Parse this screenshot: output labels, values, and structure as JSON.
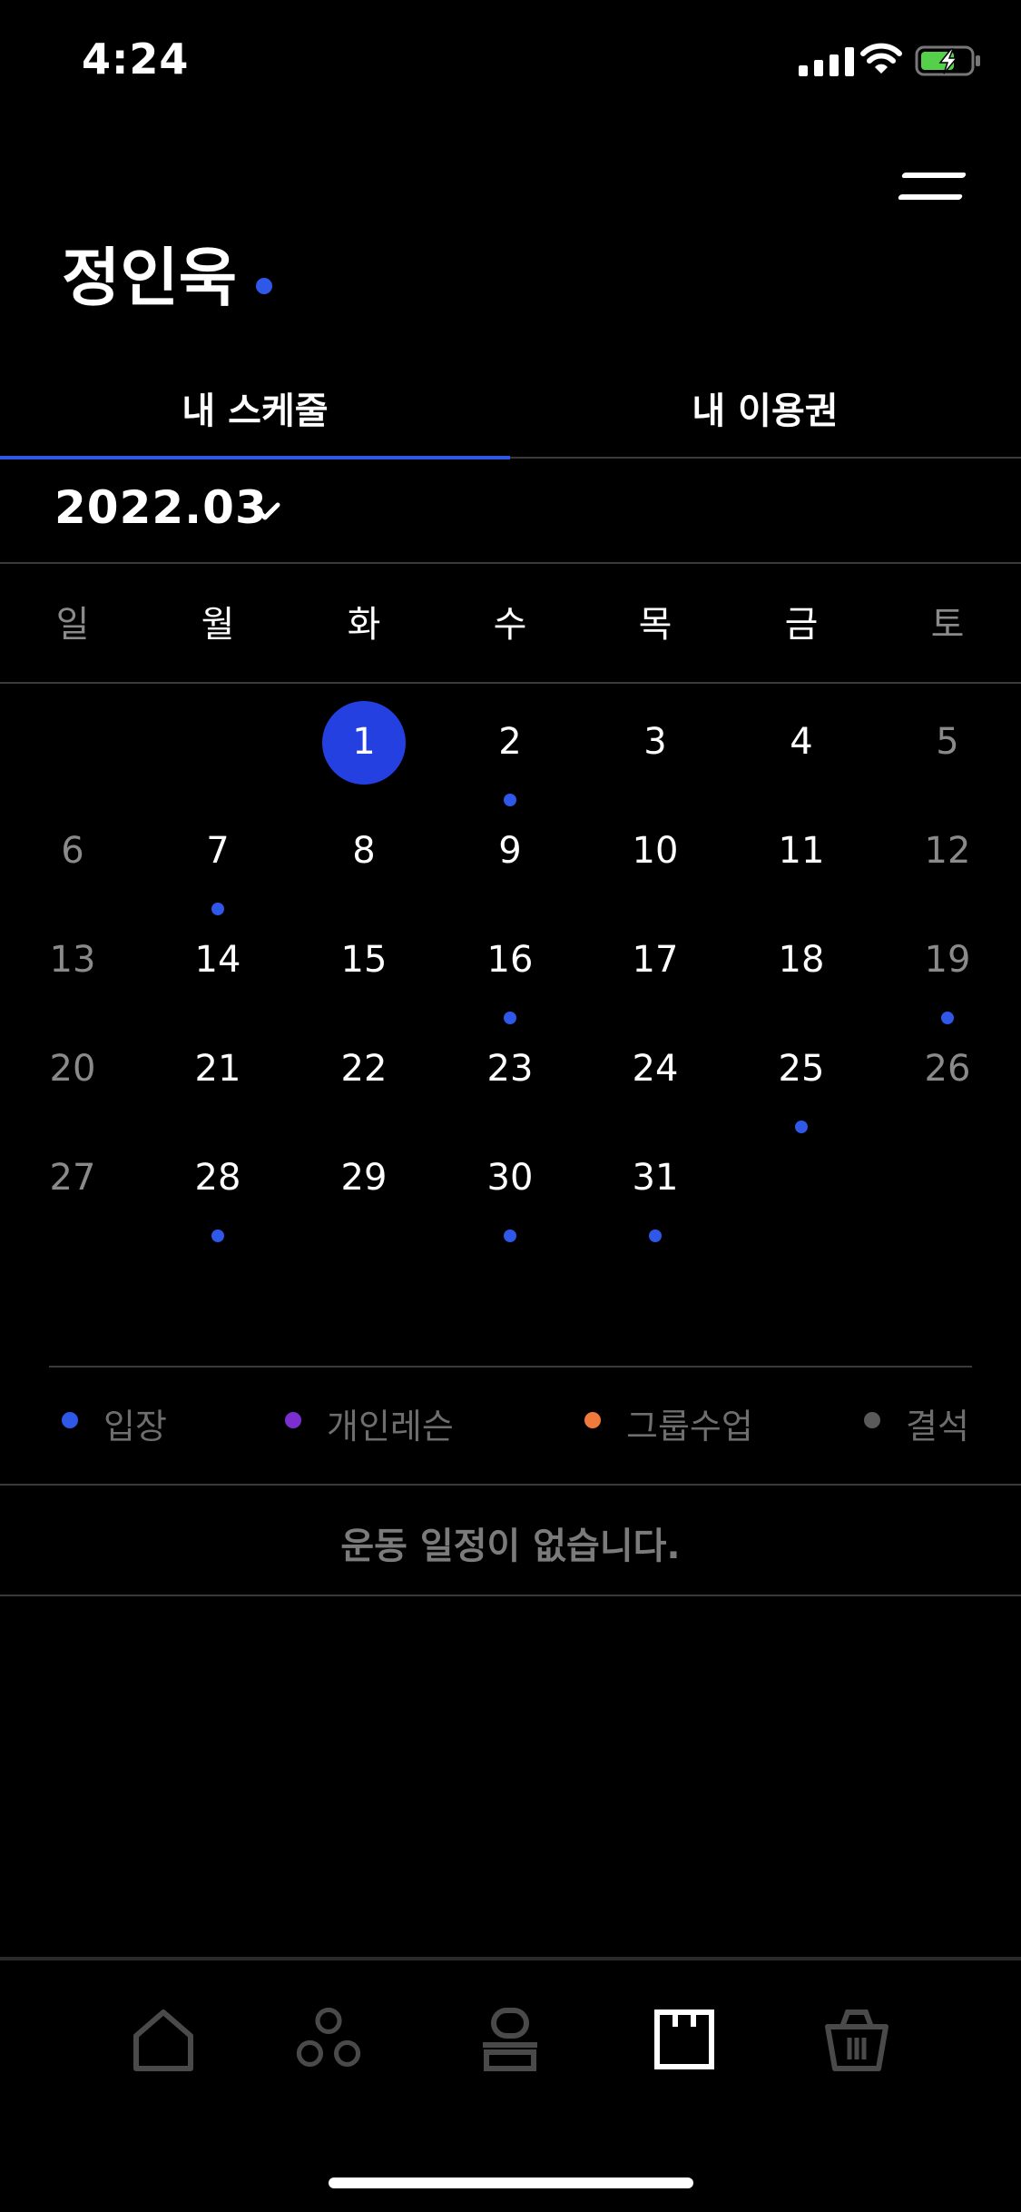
{
  "status_bar": {
    "time": "4:24"
  },
  "header": {
    "user_name": "정인욱"
  },
  "tabs": [
    {
      "label": "내 스케줄",
      "active": true
    },
    {
      "label": "내 이용권",
      "active": false
    }
  ],
  "calendar": {
    "month_label": "2022.03",
    "weekdays": [
      "일",
      "월",
      "화",
      "수",
      "목",
      "금",
      "토"
    ],
    "days": [
      {
        "label": "1",
        "today": true,
        "dot": false
      },
      {
        "label": "2",
        "dot": true
      },
      {
        "label": "3",
        "dot": false
      },
      {
        "label": "4",
        "dot": false
      },
      {
        "label": "5",
        "dot": false
      },
      {
        "label": "6",
        "dot": false
      },
      {
        "label": "7",
        "dot": true
      },
      {
        "label": "8",
        "dot": false
      },
      {
        "label": "9",
        "dot": false
      },
      {
        "label": "10",
        "dot": false
      },
      {
        "label": "11",
        "dot": false
      },
      {
        "label": "12",
        "dot": false
      },
      {
        "label": "13",
        "dot": false
      },
      {
        "label": "14",
        "dot": false
      },
      {
        "label": "15",
        "dot": false
      },
      {
        "label": "16",
        "dot": true
      },
      {
        "label": "17",
        "dot": false
      },
      {
        "label": "18",
        "dot": false
      },
      {
        "label": "19",
        "dot": true
      },
      {
        "label": "20",
        "dot": false
      },
      {
        "label": "21",
        "dot": false
      },
      {
        "label": "22",
        "dot": false
      },
      {
        "label": "23",
        "dot": false
      },
      {
        "label": "24",
        "dot": false
      },
      {
        "label": "25",
        "dot": true
      },
      {
        "label": "26",
        "dot": false
      },
      {
        "label": "27",
        "dot": false
      },
      {
        "label": "28",
        "dot": true
      },
      {
        "label": "29",
        "dot": false
      },
      {
        "label": "30",
        "dot": true
      },
      {
        "label": "31",
        "dot": true
      }
    ],
    "first_weekday_index": 2
  },
  "legend": [
    {
      "label": "입장",
      "color": "#2f57e8"
    },
    {
      "label": "개인레슨",
      "color": "#7b2fd0"
    },
    {
      "label": "그룹수업",
      "color": "#f07a3c"
    },
    {
      "label": "결석",
      "color": "#5a5a5a"
    }
  ],
  "empty_message": "운동 일정이 없습니다.",
  "bottom_nav": [
    {
      "icon": "home-icon",
      "active": false
    },
    {
      "icon": "group-icon",
      "active": false
    },
    {
      "icon": "trainer-icon",
      "active": false
    },
    {
      "icon": "schedule-icon",
      "active": true
    },
    {
      "icon": "basket-icon",
      "active": false
    }
  ],
  "colors": {
    "accent": "#2f57e8",
    "today": "#2440e0",
    "muted": "#8a8a8a"
  }
}
